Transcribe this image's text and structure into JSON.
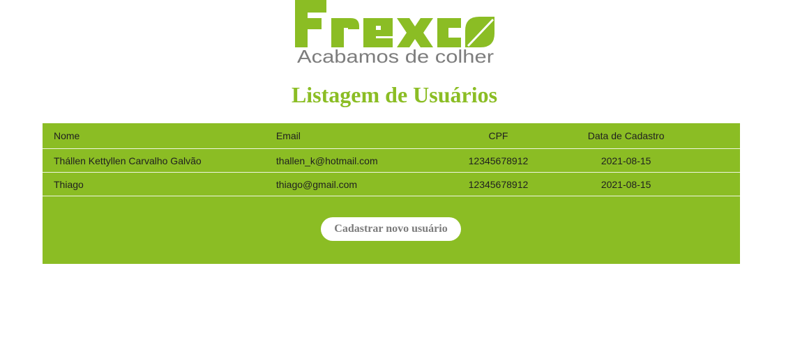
{
  "brand": {
    "name": "Frexco",
    "tagline": "Acabamos de colher",
    "color": "#8bbd24"
  },
  "page": {
    "title": "Listagem de Usuários"
  },
  "table": {
    "headers": {
      "name": "Nome",
      "email": "Email",
      "cpf": "CPF",
      "date": "Data de Cadastro"
    },
    "rows": [
      {
        "name": "Thállen Kettyllen Carvalho Galvão",
        "email": "thallen_k@hotmail.com",
        "cpf": "12345678912",
        "date": "2021-08-15"
      },
      {
        "name": "Thiago",
        "email": "thiago@gmail.com",
        "cpf": "12345678912",
        "date": "2021-08-15"
      }
    ]
  },
  "actions": {
    "register_label": "Cadastrar novo usuário"
  }
}
